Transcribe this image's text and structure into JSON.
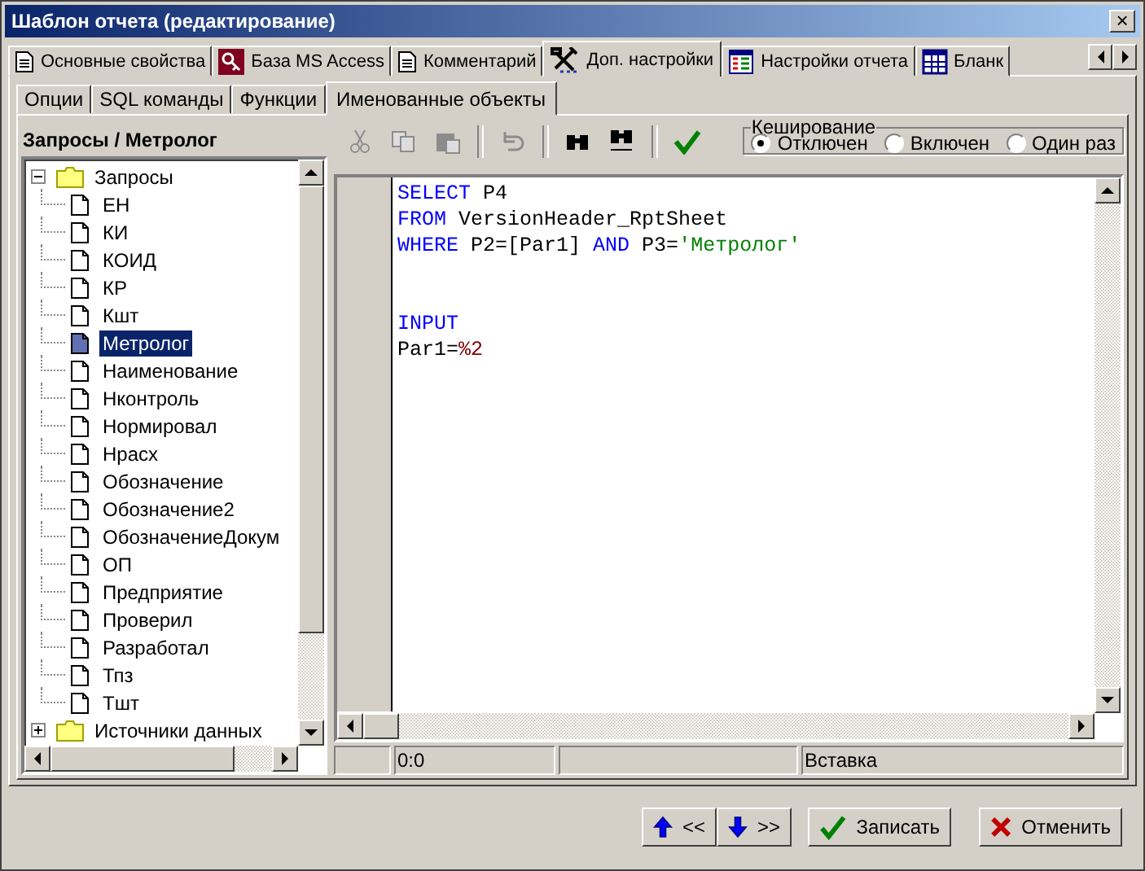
{
  "window": {
    "title": "Шаблон отчета (редактирование)",
    "close": "×"
  },
  "tabs": [
    {
      "label": "Основные свойства",
      "kind": "doc",
      "selected": false
    },
    {
      "label": "База MS Access",
      "kind": "key",
      "selected": false
    },
    {
      "label": "Комментарий",
      "kind": "doc",
      "selected": false
    },
    {
      "label": "Доп. настройки",
      "kind": "tools",
      "selected": true
    },
    {
      "label": "Настройки отчета",
      "kind": "list",
      "selected": false
    },
    {
      "label": "Бланк",
      "kind": "grid",
      "selected": false
    }
  ],
  "subtabs": [
    {
      "label": "Опции",
      "selected": false
    },
    {
      "label": "SQL команды",
      "selected": false
    },
    {
      "label": "Функции",
      "selected": false
    },
    {
      "label": "Именованные объекты",
      "selected": true
    }
  ],
  "tree_header": "Запросы / Метролог",
  "tree": [
    {
      "label": "Запросы",
      "expanded": true,
      "children": [
        {
          "label": "ЕН",
          "selected": false
        },
        {
          "label": "КИ",
          "selected": false
        },
        {
          "label": "КОИД",
          "selected": false
        },
        {
          "label": "КР",
          "selected": false
        },
        {
          "label": "Кшт",
          "selected": false
        },
        {
          "label": "Метролог",
          "selected": true
        },
        {
          "label": "Наименование",
          "selected": false
        },
        {
          "label": "Нконтроль",
          "selected": false
        },
        {
          "label": "Нормировал",
          "selected": false
        },
        {
          "label": "Нрасх",
          "selected": false
        },
        {
          "label": "Обозначение",
          "selected": false
        },
        {
          "label": "Обозначение2",
          "selected": false
        },
        {
          "label": "ОбозначениеДокум",
          "selected": false
        },
        {
          "label": "ОП",
          "selected": false
        },
        {
          "label": "Предприятие",
          "selected": false
        },
        {
          "label": "Проверил",
          "selected": false
        },
        {
          "label": "Разработал",
          "selected": false
        },
        {
          "label": "Тпз",
          "selected": false
        },
        {
          "label": "Тшт",
          "selected": false
        }
      ]
    },
    {
      "label": "Источники данных",
      "expanded": false
    }
  ],
  "toolbar": [
    {
      "kind": "cut",
      "disabled": true
    },
    {
      "kind": "copy",
      "disabled": true
    },
    {
      "kind": "paste",
      "disabled": true
    },
    {
      "kind": "sep"
    },
    {
      "kind": "undo",
      "disabled": true
    },
    {
      "kind": "sep"
    },
    {
      "kind": "find",
      "disabled": false
    },
    {
      "kind": "replace",
      "disabled": false
    },
    {
      "kind": "sep"
    },
    {
      "kind": "apply"
    }
  ],
  "caching": {
    "title": "Кеширование",
    "options": [
      {
        "label": "Отключен",
        "selected": true
      },
      {
        "label": "Включен",
        "selected": false
      },
      {
        "label": "Один раз",
        "selected": false
      }
    ]
  },
  "code": [
    {
      "kind": "code",
      "tokens": [
        {
          "text": "SELECT",
          "kind": "keyword"
        },
        {
          "text": " P4",
          "kind": "plain"
        }
      ]
    },
    {
      "kind": "code",
      "tokens": [
        {
          "text": "FROM",
          "kind": "keyword"
        },
        {
          "text": " VersionHeader_RptSheet",
          "kind": "plain"
        }
      ]
    },
    {
      "kind": "code",
      "tokens": [
        {
          "text": "WHERE",
          "kind": "keyword"
        },
        {
          "text": " P2=[Par1] ",
          "kind": "plain"
        },
        {
          "text": "AND",
          "kind": "keyword"
        },
        {
          "text": " P3=",
          "kind": "plain"
        },
        {
          "text": "'Метролог'",
          "kind": "string"
        }
      ]
    },
    {
      "kind": "blank"
    },
    {
      "kind": "blank"
    },
    {
      "kind": "code",
      "tokens": [
        {
          "text": "INPUT",
          "kind": "keyword"
        }
      ]
    },
    {
      "kind": "code",
      "tokens": [
        {
          "text": "Par1=",
          "kind": "plain"
        },
        {
          "text": "%2",
          "kind": "param"
        }
      ]
    }
  ],
  "status_bar": [
    "0:0",
    "Вставка"
  ],
  "buttons": [
    {
      "kind": "up",
      "label": "<<"
    },
    {
      "kind": "down",
      "label": ">>"
    },
    {
      "kind": "save",
      "label": "Записать"
    },
    {
      "kind": "cancel",
      "label": "Отменить"
    }
  ]
}
